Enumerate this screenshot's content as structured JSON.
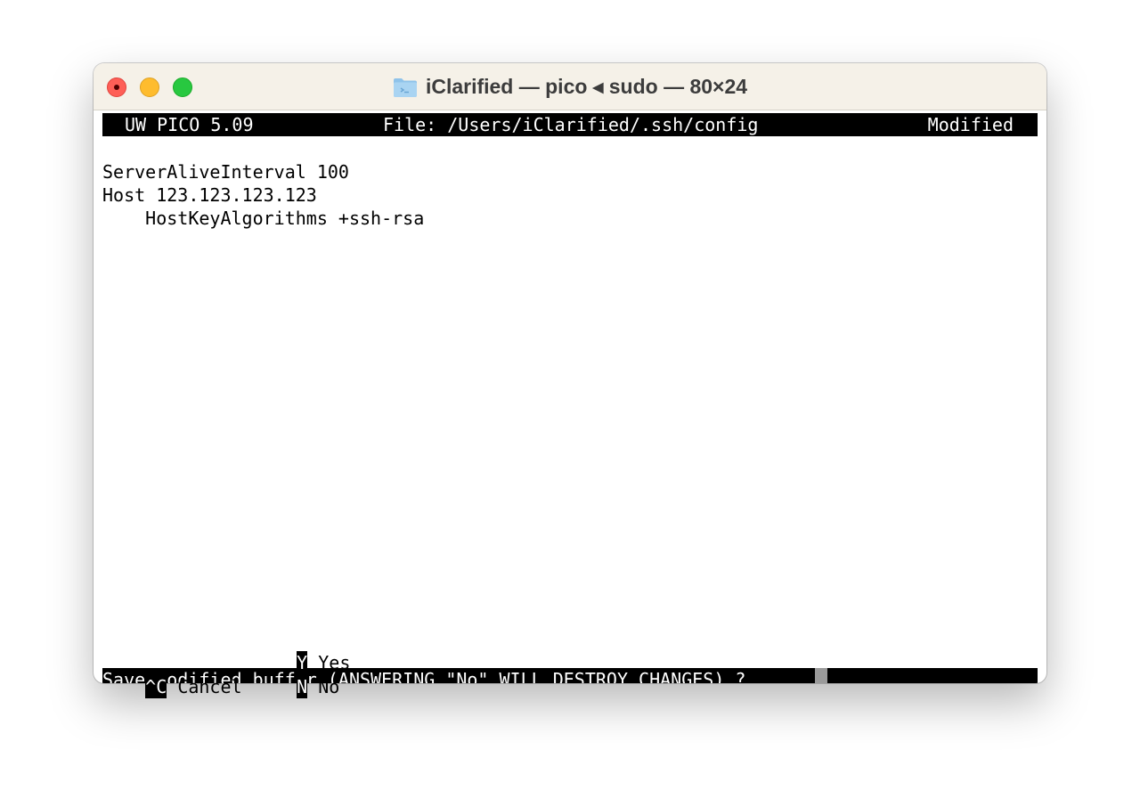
{
  "window": {
    "title": "iClarified — pico ◂ sudo — 80×24"
  },
  "colors": {
    "close": "#fe5f57",
    "minimize": "#febc2e",
    "zoom": "#28c840",
    "titlebar": "#f5f1e8",
    "folder": "#a9d4f2"
  },
  "icons": {
    "folder": "folder-icon"
  },
  "pico": {
    "header": {
      "app": "UW PICO 5.09",
      "file": "File: /Users/iClarified/.ssh/config",
      "status": "Modified"
    },
    "buffer": [
      "ServerAliveInterval 100",
      "Host 123.123.123.123",
      "    HostKeyAlgorithms +ssh-rsa"
    ],
    "prompt": "Save modified buffer (ANSWERING \"No\" WILL DESTROY CHANGES) ?",
    "options": [
      {
        "key": "Y",
        "label": "Yes"
      },
      {
        "key": "N",
        "label": "No"
      }
    ],
    "cancel": {
      "key": "^C",
      "label": "Cancel"
    }
  }
}
